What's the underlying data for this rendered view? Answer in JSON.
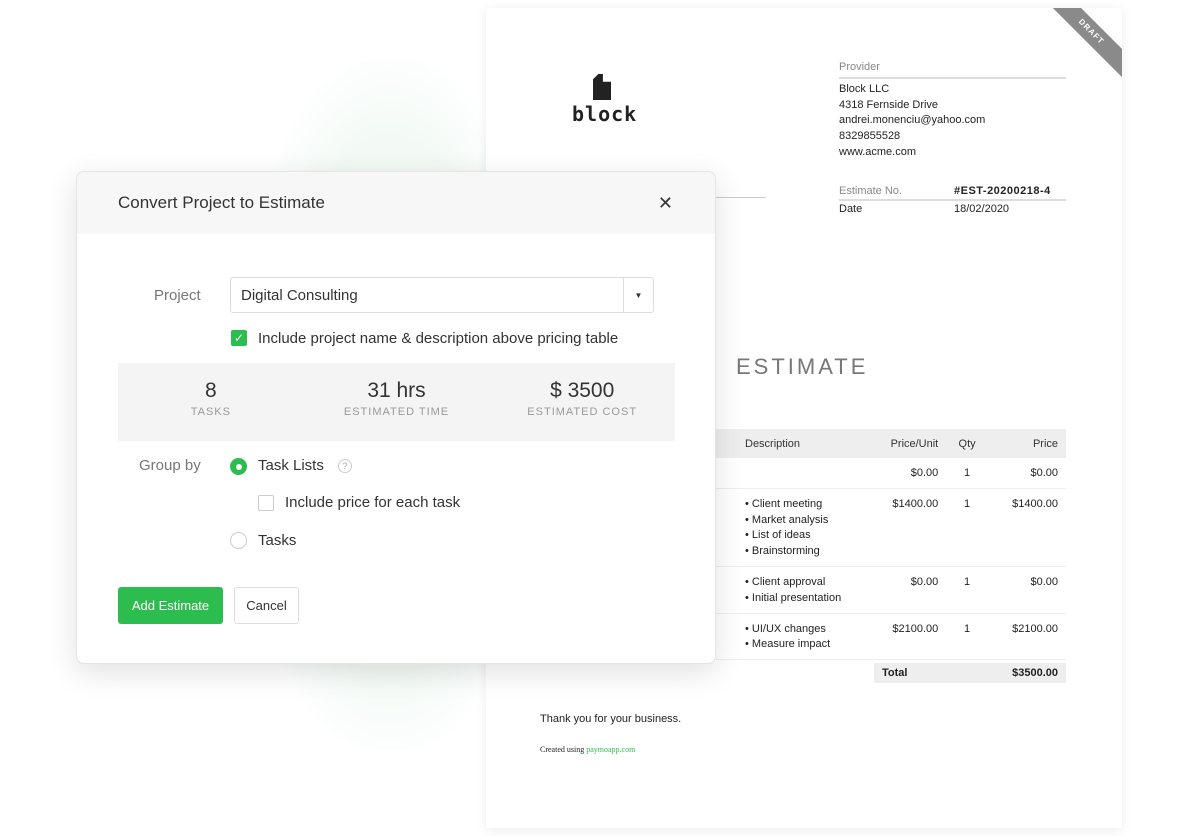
{
  "dialog": {
    "title": "Convert Project to Estimate",
    "project_label": "Project",
    "project_value": "Digital Consulting",
    "include_label": "Include project name & description above pricing table",
    "stats": [
      {
        "value": "8",
        "label": "TASKS"
      },
      {
        "value": "31 hrs",
        "label": "ESTIMATED TIME"
      },
      {
        "value": "$ 3500",
        "label": "ESTIMATED COST"
      }
    ],
    "group_by_label": "Group by",
    "task_lists_label": "Task Lists",
    "help": "?",
    "include_price_label": "Include price for each task",
    "tasks_label": "Tasks",
    "add_button": "Add Estimate",
    "cancel_button": "Cancel",
    "accent": "#2dbd4e"
  },
  "document": {
    "ribbon": "DRAFT",
    "logo_text": "block",
    "provider_label": "Provider",
    "provider": [
      "Block LLC",
      "4318 Fernside Drive",
      "andrei.monenciu@yahoo.com",
      "8329855528",
      "www.acme.com"
    ],
    "estimate_no_label": "Estimate No.",
    "estimate_no": "#EST-20200218-4",
    "date_label": "Date",
    "date": "18/02/2020",
    "title": "ESTIMATE",
    "columns": [
      "Description",
      "Price/Unit",
      "Qty",
      "Price"
    ],
    "rows": [
      {
        "items": [],
        "unit": "$0.00",
        "qty": "1",
        "price": "$0.00"
      },
      {
        "items": [
          "Client meeting",
          "Market analysis",
          "List of ideas",
          "Brainstorming"
        ],
        "unit": "$1400.00",
        "qty": "1",
        "price": "$1400.00"
      },
      {
        "items": [
          "Client approval",
          "Initial presentation"
        ],
        "unit": "$0.00",
        "qty": "1",
        "price": "$0.00"
      },
      {
        "items": [
          "UI/UX changes",
          "Measure impact"
        ],
        "unit": "$2100.00",
        "qty": "1",
        "price": "$2100.00"
      }
    ],
    "total_label": "Total",
    "total": "$3500.00",
    "thanks": "Thank you for your business.",
    "created_prefix": "Created using",
    "created_link": "paymoapp.com"
  }
}
